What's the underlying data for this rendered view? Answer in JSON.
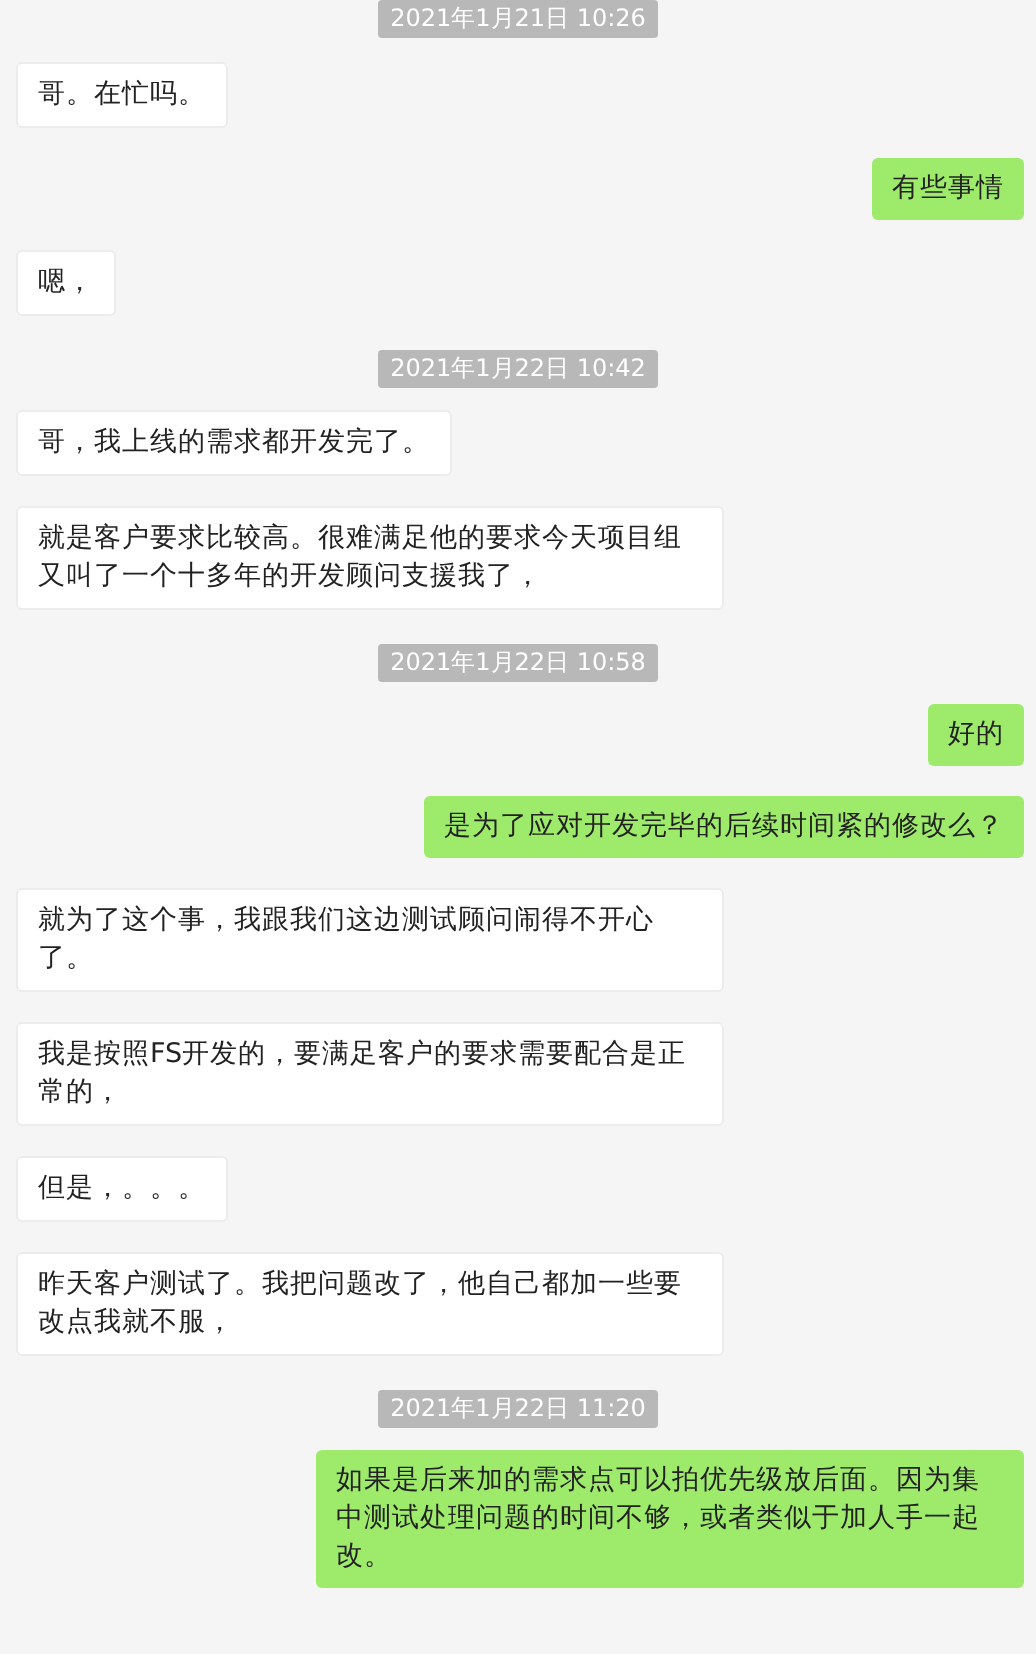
{
  "messages": [
    {
      "kind": "time",
      "text": "2021年1月21日 10:26"
    },
    {
      "kind": "received",
      "text": "哥。在忙吗。"
    },
    {
      "kind": "sent",
      "text": "有些事情"
    },
    {
      "kind": "received",
      "text": "嗯，"
    },
    {
      "kind": "time",
      "text": "2021年1月22日 10:42"
    },
    {
      "kind": "received",
      "text": "哥，我上线的需求都开发完了。"
    },
    {
      "kind": "received",
      "text": "就是客户要求比较高。很难满足他的要求今天项目组又叫了一个十多年的开发顾问支援我了，"
    },
    {
      "kind": "time",
      "text": "2021年1月22日 10:58"
    },
    {
      "kind": "sent",
      "text": "好的"
    },
    {
      "kind": "sent",
      "text": "是为了应对开发完毕的后续时间紧的修改么？"
    },
    {
      "kind": "received",
      "text": "就为了这个事，我跟我们这边测试顾问闹得不开心了。"
    },
    {
      "kind": "received",
      "text": "我是按照FS开发的，要满足客户的要求需要配合是正常的，"
    },
    {
      "kind": "received",
      "text": "但是，。。。"
    },
    {
      "kind": "received",
      "text": "昨天客户测试了。我把问题改了，他自己都加一些要改点我就不服，"
    },
    {
      "kind": "time",
      "text": "2021年1月22日 11:20"
    },
    {
      "kind": "sent",
      "text": "如果是后来加的需求点可以拍优先级放后面。因为集中测试处理问题的时间不够，或者类似于加人手一起改。"
    }
  ]
}
